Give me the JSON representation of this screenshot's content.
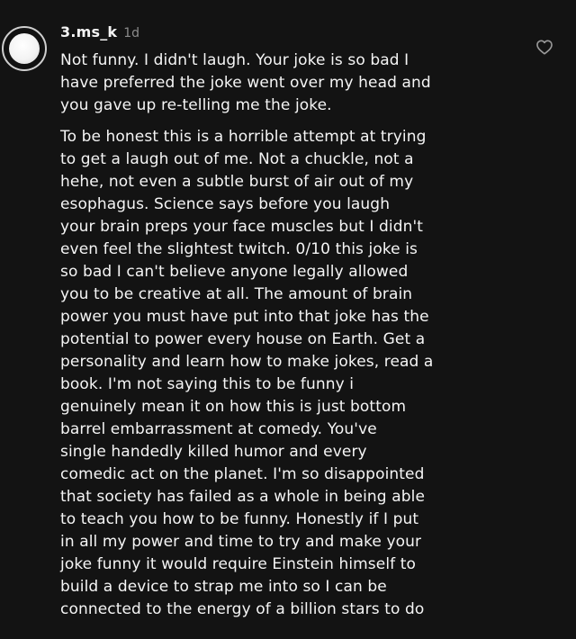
{
  "comment": {
    "username": "3.ms_k",
    "timestamp": "1d",
    "paragraph1": [
      "Not funny. I didn't laugh. Your joke is so bad I",
      "have preferred the joke went over my head and",
      "you gave up re-telling me the joke."
    ],
    "paragraph2": [
      "To be honest this is a horrible attempt at trying",
      "to get a laugh out of me. Not a chuckle, not a",
      "hehe, not even a subtle burst of air out of my",
      "esophagus. Science says before you laugh",
      "your brain preps your face muscles but I didn't",
      "even feel the slightest twitch. 0/10 this joke is",
      "so bad I can't believe anyone legally allowed",
      "you to be creative at all. The amount of brain",
      "power you must have put into that joke has the",
      "potential to power every house on Earth. Get a",
      "personality and learn how to make jokes, read a",
      "book. I'm not saying this to be funny i",
      "genuinely mean it on how this is just bottom",
      "barrel embarrassment at comedy. You've",
      "single handedly killed humor and every",
      "comedic act on the planet. I'm so disappointed",
      "that society has failed as a whole in being able",
      "to teach you how to be funny. Honestly if I put",
      "in all my power and time to try and make your",
      "joke funny it would require Einstein himself to",
      "build a device to strap me into so I can be",
      "connected to the energy of a billion stars to do"
    ]
  },
  "icons": {
    "like": "heart-outline-icon"
  },
  "colors": {
    "background": "#131313",
    "text": "#f5f5f5",
    "timestamp": "#8b8b8b"
  }
}
